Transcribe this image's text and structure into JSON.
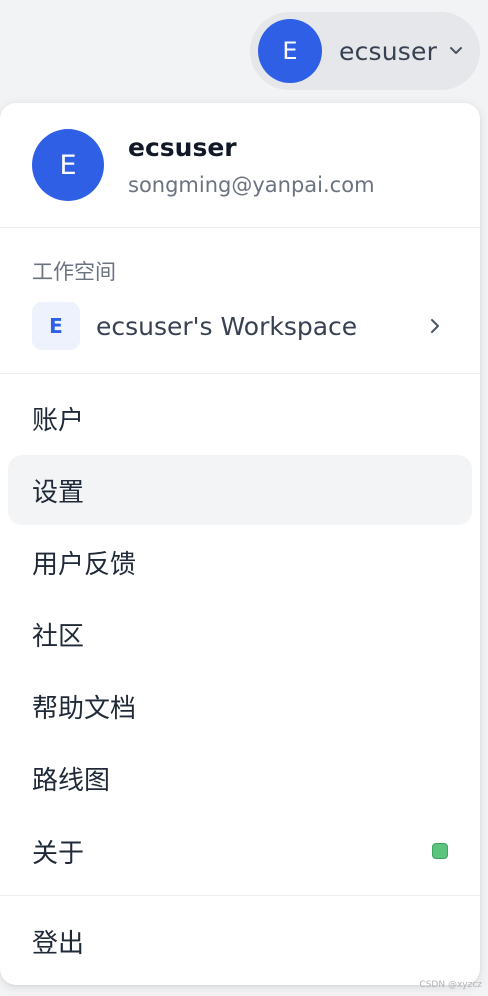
{
  "topbar": {
    "avatar_initial": "E",
    "username": "ecsuser"
  },
  "menu": {
    "header": {
      "avatar_initial": "E",
      "name": "ecsuser",
      "email": "songming@yanpai.com"
    },
    "workspace_section": {
      "label": "工作空间",
      "workspace": {
        "badge": "E",
        "name": "ecsuser's Workspace"
      }
    },
    "items": [
      {
        "label": "账户"
      },
      {
        "label": "设置"
      },
      {
        "label": "用户反馈"
      },
      {
        "label": "社区"
      },
      {
        "label": "帮助文档"
      },
      {
        "label": "路线图"
      },
      {
        "label": "关于"
      }
    ],
    "logout_label": "登出"
  },
  "colors": {
    "accent": "#2e5fe5",
    "status_green": "#5cc47e",
    "hover_bg": "#f3f4f6"
  },
  "watermark": "CSDN @xyzcz"
}
